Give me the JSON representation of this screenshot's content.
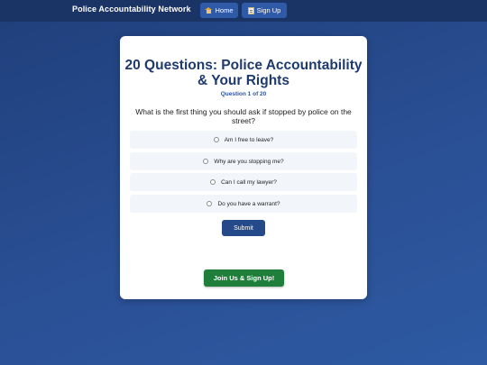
{
  "header": {
    "brand": "Police Accountability Network",
    "nav": [
      {
        "icon": "house-icon",
        "label": "Home"
      },
      {
        "icon": "memo-icon",
        "label": "Sign Up"
      }
    ]
  },
  "quiz": {
    "title": "20 Questions: Police Accountability & Your Rights",
    "progress": "Question 1 of 20",
    "question": "What is the first thing you should ask if stopped by police on the street?",
    "options": [
      "Am I free to leave?",
      "Why are you stopping me?",
      "Can I call my lawyer?",
      "Do you have a warrant?"
    ],
    "submit_label": "Submit",
    "join_label": "Join Us & Sign Up!"
  },
  "colors": {
    "topbar": "#1b3466",
    "nav_button": "#2e5aa8",
    "title": "#1e3a6e",
    "submit": "#244a8a",
    "join": "#1e7e3a",
    "option_bg": "#f2f6fb"
  }
}
